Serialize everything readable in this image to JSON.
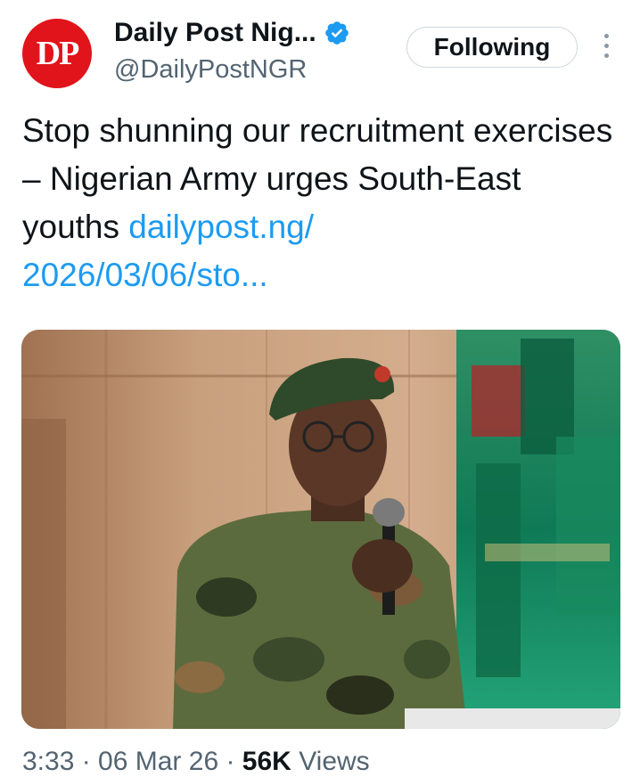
{
  "account": {
    "avatar_text": "DP",
    "display_name": "Daily Post Nig...",
    "handle": "@DailyPostNGR",
    "verified": true,
    "follow_button": "Following"
  },
  "tweet": {
    "text": "Stop shunning our recruitment exercises – Nigerian Army urges South-East youths",
    "link": "dailypost.ng/\n2026/03/06/sto..."
  },
  "media": {
    "description_icon": "photo-army-officer-speaking"
  },
  "footer": {
    "timestamp": "3:33 · 06 Mar 26",
    "views_count": "56K",
    "views_label": "Views"
  },
  "colors": {
    "brand_red": "#e1141b",
    "link_blue": "#1d9bf0",
    "verified_blue": "#1d9bf0",
    "secondary_text": "#536471"
  }
}
